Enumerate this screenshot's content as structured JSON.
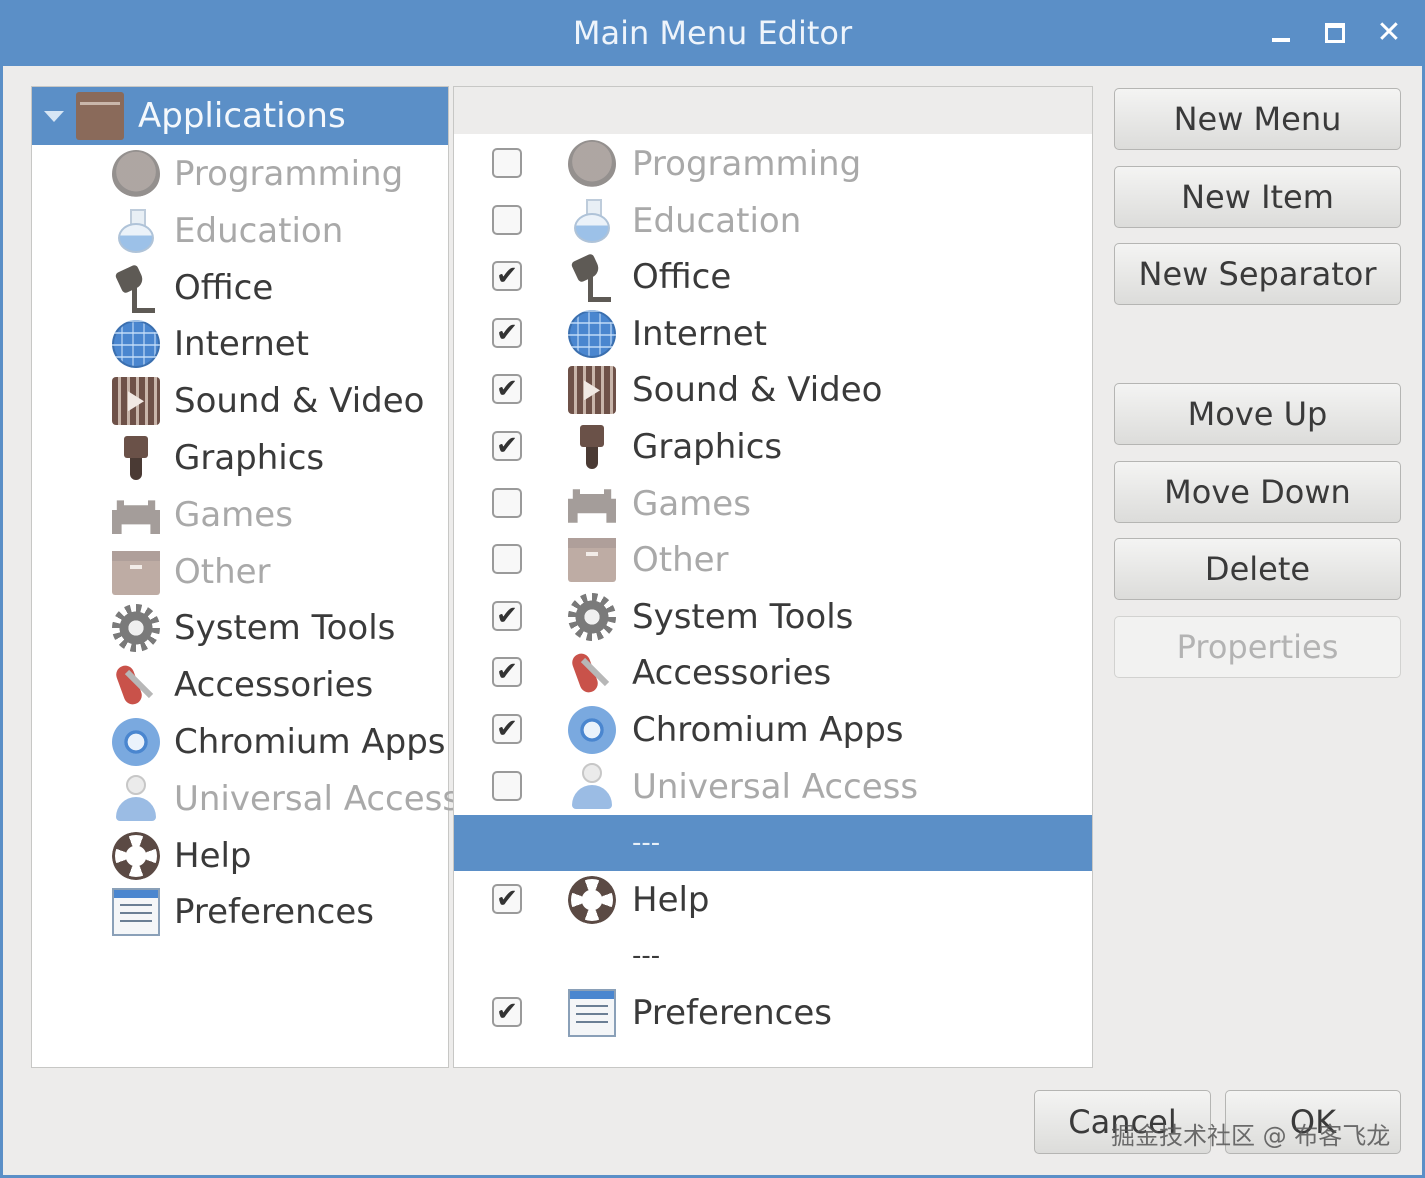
{
  "window": {
    "title": "Main Menu Editor"
  },
  "tree": {
    "root": {
      "label": "Applications",
      "icon": "folder-icon"
    },
    "items": [
      {
        "label": "Programming",
        "icon": "programming-icon",
        "enabled": false
      },
      {
        "label": "Education",
        "icon": "education-icon",
        "enabled": false
      },
      {
        "label": "Office",
        "icon": "office-icon",
        "enabled": true
      },
      {
        "label": "Internet",
        "icon": "internet-icon",
        "enabled": true
      },
      {
        "label": "Sound & Video",
        "icon": "sound-video-icon",
        "enabled": true
      },
      {
        "label": "Graphics",
        "icon": "graphics-icon",
        "enabled": true
      },
      {
        "label": "Games",
        "icon": "games-icon",
        "enabled": false
      },
      {
        "label": "Other",
        "icon": "other-icon",
        "enabled": false
      },
      {
        "label": "System Tools",
        "icon": "system-tools-icon",
        "enabled": true
      },
      {
        "label": "Accessories",
        "icon": "accessories-icon",
        "enabled": true
      },
      {
        "label": "Chromium Apps",
        "icon": "chromium-icon",
        "enabled": true
      },
      {
        "label": "Universal Access",
        "icon": "universal-access-icon",
        "enabled": false
      },
      {
        "label": "Help",
        "icon": "help-icon",
        "enabled": true
      },
      {
        "label": "Preferences",
        "icon": "preferences-icon",
        "enabled": true
      }
    ]
  },
  "list": {
    "rows": [
      {
        "label": "Programming",
        "checked": false
      },
      {
        "label": "Education",
        "checked": false
      },
      {
        "label": "Office",
        "checked": true
      },
      {
        "label": "Internet",
        "checked": true
      },
      {
        "label": "Sound & Video",
        "checked": true
      },
      {
        "label": "Graphics",
        "checked": true
      },
      {
        "label": "Games",
        "checked": false
      },
      {
        "label": "Other",
        "checked": false
      },
      {
        "label": "System Tools",
        "checked": true
      },
      {
        "label": "Accessories",
        "checked": true
      },
      {
        "label": "Chromium Apps",
        "checked": true
      },
      {
        "label": "Universal Access",
        "checked": false
      },
      {
        "label": "---",
        "separator": true,
        "selected": true
      },
      {
        "label": "Help",
        "checked": true
      },
      {
        "label": "---",
        "separator": true
      },
      {
        "label": "Preferences",
        "checked": true
      }
    ],
    "check_mark": "✔"
  },
  "buttons": {
    "new_menu": "New Menu",
    "new_item": "New Item",
    "new_separator": "New Separator",
    "move_up": "Move Up",
    "move_down": "Move Down",
    "delete": "Delete",
    "properties": "Properties",
    "cancel": "Cancel",
    "ok": "OK"
  },
  "watermark": "掘金技术社区 @ 布客飞龙",
  "colors": {
    "accent": "#5b8fc7",
    "window_bg": "#edeceb"
  }
}
